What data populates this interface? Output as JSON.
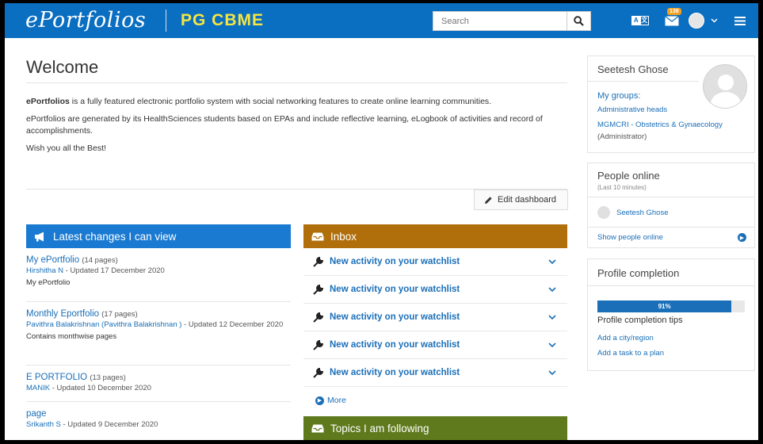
{
  "header": {
    "logo": "ePortfolios",
    "site_name": "PG CBME",
    "search_placeholder": "Search",
    "notification_count": "138"
  },
  "welcome": {
    "title": "Welcome",
    "p1_bold": "ePortfolios",
    "p1_rest": " is a fully featured electronic portfolio system with social networking features to create online learning communities.",
    "p2": "ePortfolios are generated by its HealthSciences students based on EPAs and include reflective learning, eLogbook of activities and record of accomplishments.",
    "p3": "Wish you all the Best!",
    "edit_dashboard": "Edit dashboard"
  },
  "latest_changes": {
    "title": "Latest changes I can view",
    "items": [
      {
        "title": "My ePortfolio",
        "count": "(14 pages)",
        "author": "Hirshitha N",
        "updated": " - Updated 17 December 2020",
        "desc": "My ePortfolio"
      },
      {
        "title": "Monthly Eportfolio",
        "count": "(17 pages)",
        "author": "Pavithra Balakrishnan (Pavithra Balakrishnan )",
        "updated": " - Updated 12 December 2020",
        "desc": "Contains monthwise pages"
      },
      {
        "title": "E PORTFOLIO",
        "count": "(13 pages)",
        "author": "MANIK",
        "updated": " - Updated 10 December 2020",
        "desc": ""
      },
      {
        "title": "page",
        "count": "",
        "author": "Srikanth S",
        "updated": " - Updated 9 December 2020",
        "desc": ""
      }
    ]
  },
  "inbox": {
    "title": "Inbox",
    "items": [
      "New activity on your watchlist",
      "New activity on your watchlist",
      "New activity on your watchlist",
      "New activity on your watchlist",
      "New activity on your watchlist"
    ],
    "more": "More"
  },
  "topics": {
    "title": "Topics I am following"
  },
  "profile_box": {
    "name": "Seetesh Ghose",
    "groups_label": "My groups:",
    "group1": "Administrative heads",
    "group2": "MGMCRI - Obstetrics & Gynaecology",
    "group2_role": "(Administrator)"
  },
  "people_online": {
    "title": "People online",
    "subtitle": "(Last 10 minutes)",
    "user": "Seetesh Ghose",
    "show_link": "Show people online"
  },
  "profile_completion": {
    "title": "Profile completion",
    "percent_label": "91%",
    "progress_fraction": 0.91,
    "tips_title": "Profile completion tips",
    "tip1": "Add a city/region",
    "tip2": "Add a task to a plan"
  }
}
